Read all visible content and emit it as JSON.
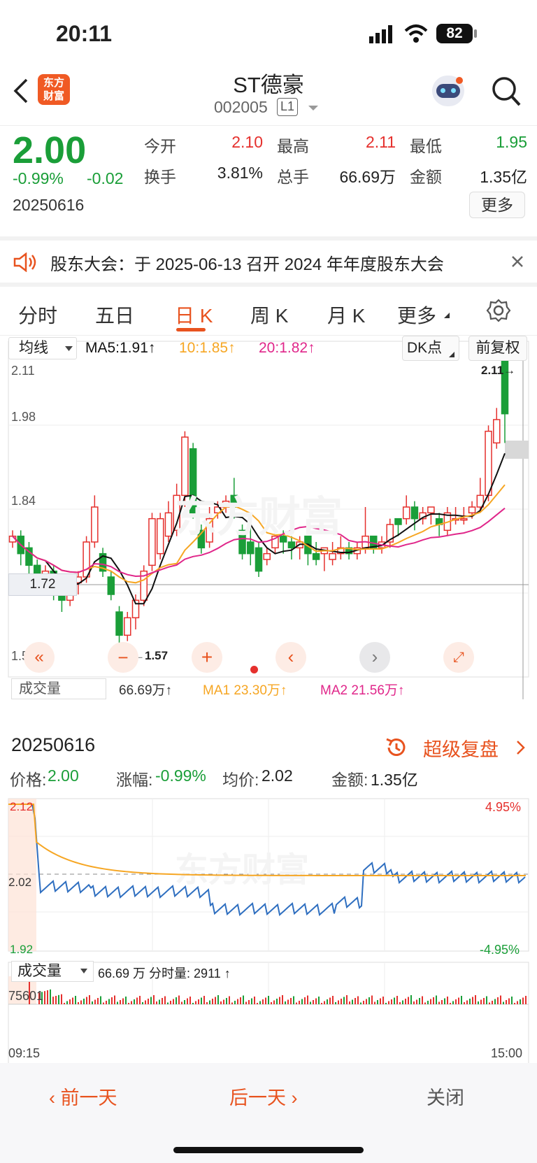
{
  "status": {
    "time": "20:11",
    "battery": "82"
  },
  "nav": {
    "title": "ST德豪",
    "code": "002005",
    "level": "L1",
    "logo_line1": "东方",
    "logo_line2": "财富"
  },
  "quote": {
    "price": "2.00",
    "change_pct": "-0.99%",
    "change": "-0.02",
    "date": "20250616",
    "open_label": "今开",
    "open": "2.10",
    "high_label": "最高",
    "high": "2.11",
    "low_label": "最低",
    "low": "1.95",
    "turnover_label": "换手",
    "turnover": "3.81%",
    "volume_label": "总手",
    "volume": "66.69万",
    "amount_label": "金额",
    "amount": "1.35亿",
    "more_button": "更多"
  },
  "notice": {
    "text": "股东大会：于 2025-06-13 召开 2024 年年度股东大会"
  },
  "tabs": [
    "分时",
    "五日",
    "日 K",
    "周 K",
    "月 K",
    "更多"
  ],
  "kline": {
    "indicator_select": "均线",
    "ma5": "MA5:1.91↑",
    "ma10": "10:1.85↑",
    "ma20": "20:1.82↑",
    "dk_button": "DK点",
    "fq_button": "前复权",
    "axis": [
      "2.11",
      "1.98",
      "1.84",
      "1.57"
    ],
    "crosshair_label": "1.72",
    "max_marker": "2.11→",
    "min_marker": "←1.57",
    "vol_select": "成交量",
    "vol_text": "66.69万↑",
    "vol_ma1": "MA1 23.30万↑",
    "vol_ma2": "MA2 21.56万↑",
    "colors": {
      "up": "#e5302d",
      "down": "#1a9e38",
      "ma5": "#111111",
      "ma10": "#f6a623",
      "ma20": "#e0268a",
      "accent": "#e8531f"
    }
  },
  "detail": {
    "date": "20250616",
    "replay_button": "超级复盘",
    "price_label": "价格:",
    "price": "2.00",
    "pct_label": "涨幅:",
    "pct": "-0.99%",
    "avg_label": "均价:",
    "avg": "2.02",
    "amount_label": "金额:",
    "amount": "1.35亿",
    "y_top": "2.12",
    "y_mid": "2.02",
    "y_bot": "1.92",
    "pct_top": "4.95%",
    "pct_bot": "-4.95%",
    "vol_select": "成交量",
    "vol_text": "66.69 万 分时量: 2911 ↑",
    "vol_max": "75601",
    "time_start": "09:15",
    "time_end": "15:00"
  },
  "bottom": {
    "prev": "前一天",
    "next": "后一天",
    "close": "关闭"
  }
}
